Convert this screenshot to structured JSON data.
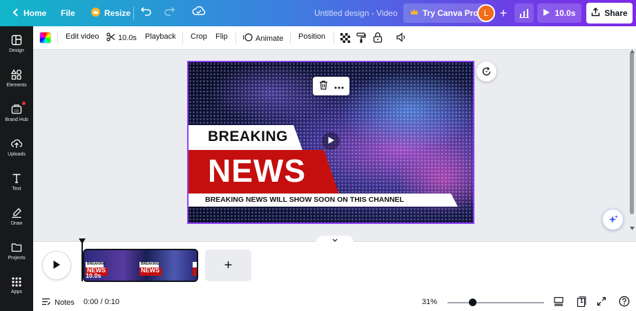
{
  "topbar": {
    "home_label": "Home",
    "file_label": "File",
    "resize_label": "Resize",
    "design_title": "Untitled design - Video",
    "pro_label": "Try Canva Pro",
    "avatar_letter": "L",
    "play_duration": "10.0s",
    "share_label": "Share",
    "gradient_start": "#10b6c8",
    "gradient_end": "#7d2ae8",
    "crown_color": "#f9b52a"
  },
  "sidebar": {
    "items": [
      {
        "label": "Design",
        "icon": "layout-icon"
      },
      {
        "label": "Elements",
        "icon": "shapes-icon"
      },
      {
        "label": "Brand Hub",
        "icon": "brand-icon"
      },
      {
        "label": "Uploads",
        "icon": "upload-icon"
      },
      {
        "label": "Text",
        "icon": "text-icon"
      },
      {
        "label": "Draw",
        "icon": "draw-icon"
      },
      {
        "label": "Projects",
        "icon": "folder-icon"
      },
      {
        "label": "Apps",
        "icon": "apps-icon"
      }
    ]
  },
  "toolbar": {
    "edit_video": "Edit video",
    "duration": "10.0s",
    "playback": "Playback",
    "crop": "Crop",
    "flip": "Flip",
    "animate": "Animate",
    "position": "Position"
  },
  "canvas": {
    "headline_top": "BREAKING",
    "headline_main": "NEWS",
    "subline": "BREAKING NEWS WILL SHOW SOON ON THIS CHANNEL",
    "accent_red": "#c50f0f",
    "selection_color": "#8b3dff"
  },
  "timeline": {
    "clip_duration": "10.0s",
    "add_label": "+",
    "clip_breaking": "BREAKING",
    "clip_news": "NEWS"
  },
  "footer": {
    "notes_label": "Notes",
    "time": "0:00 / 0:10",
    "zoom": "31%",
    "page_count": "1",
    "zoom_fraction": 0.26
  }
}
